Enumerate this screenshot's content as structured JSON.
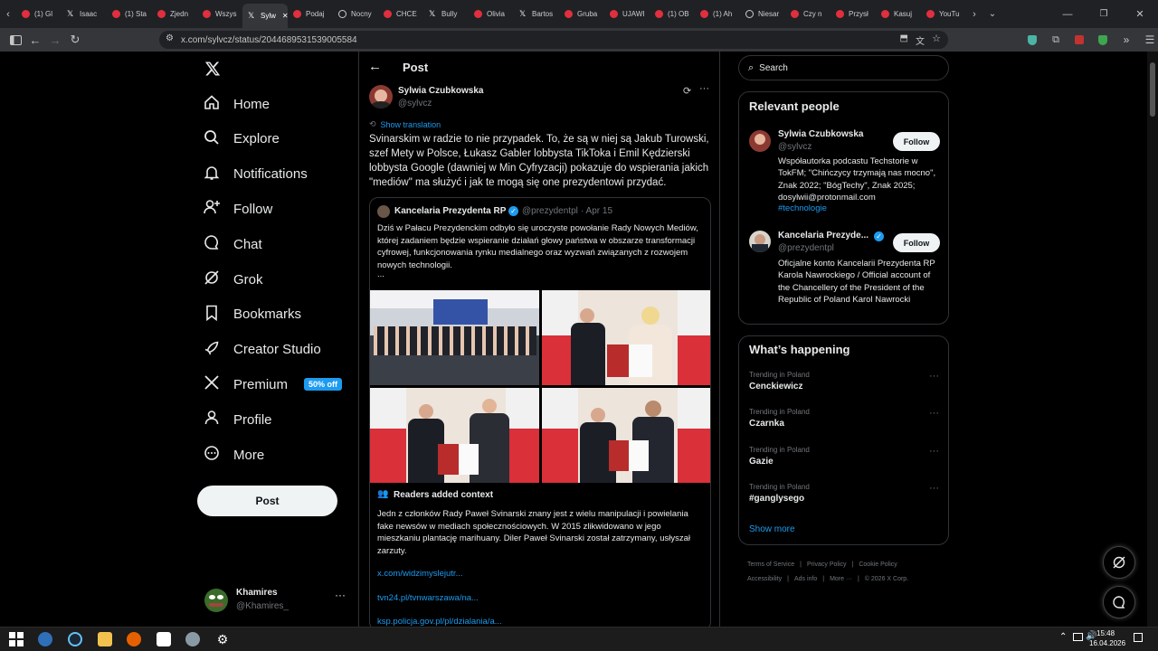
{
  "browser": {
    "tabs": [
      {
        "label": "(1) Gl",
        "icon": "youtube-icon",
        "color": "#e02f3f"
      },
      {
        "label": "Isaac",
        "icon": "x-icon",
        "color": "#ffffff"
      },
      {
        "label": "(1) Sta",
        "icon": "youtube-icon",
        "color": "#e02f3f"
      },
      {
        "label": "Zjedn",
        "icon": "youtube-icon",
        "color": "#e02f3f"
      },
      {
        "label": "Wszys",
        "icon": "youtube-icon",
        "color": "#e02f3f"
      },
      {
        "label": "Sylw",
        "icon": "x-icon",
        "color": "#ffffff",
        "active": true
      },
      {
        "label": "Podaj",
        "icon": "youtube-icon",
        "color": "#e02f3f"
      },
      {
        "label": "Nocny",
        "icon": "globe-icon",
        "color": "#c9cdd2"
      },
      {
        "label": "CHCE",
        "icon": "youtube-icon",
        "color": "#e02f3f"
      },
      {
        "label": "Bully",
        "icon": "x-icon",
        "color": "#ffffff"
      },
      {
        "label": "Olivia",
        "icon": "youtube-icon",
        "color": "#e02f3f"
      },
      {
        "label": "Bartos",
        "icon": "x-icon",
        "color": "#ffffff"
      },
      {
        "label": "Gruba",
        "icon": "youtube-icon",
        "color": "#e02f3f"
      },
      {
        "label": "UJAWI",
        "icon": "youtube-icon",
        "color": "#e02f3f"
      },
      {
        "label": "(1) OB",
        "icon": "youtube-icon",
        "color": "#e02f3f"
      },
      {
        "label": "(1) Ah",
        "icon": "youtube-icon",
        "color": "#e02f3f"
      },
      {
        "label": "Niesar",
        "icon": "globe-icon",
        "color": "#c9cdd2"
      },
      {
        "label": "Czy n",
        "icon": "youtube-icon",
        "color": "#e02f3f"
      },
      {
        "label": "Przysł",
        "icon": "youtube-icon",
        "color": "#e02f3f"
      },
      {
        "label": "Kasuj",
        "icon": "youtube-icon",
        "color": "#e02f3f"
      },
      {
        "label": "YouTu",
        "icon": "youtube-icon",
        "color": "#e02f3f"
      }
    ],
    "url": "x.com/sylvcz/status/2044689531539005584"
  },
  "nav": {
    "items": [
      {
        "label": "Home",
        "icon": "home-icon"
      },
      {
        "label": "Explore",
        "icon": "search-icon"
      },
      {
        "label": "Notifications",
        "icon": "bell-icon"
      },
      {
        "label": "Follow",
        "icon": "add-person-icon"
      },
      {
        "label": "Chat",
        "icon": "chat-icon"
      },
      {
        "label": "Grok",
        "icon": "grok-icon"
      },
      {
        "label": "Bookmarks",
        "icon": "bookmark-icon"
      },
      {
        "label": "Creator Studio",
        "icon": "rocket-icon"
      },
      {
        "label": "Premium",
        "icon": "x-logo-icon",
        "badge": "50% off"
      },
      {
        "label": "Profile",
        "icon": "person-icon"
      },
      {
        "label": "More",
        "icon": "more-circle-icon"
      }
    ],
    "post_button": "Post",
    "account": {
      "name": "Khamires",
      "handle": "@Khamires_"
    }
  },
  "post": {
    "header_title": "Post",
    "author": {
      "name": "Sylwia Czubkowska",
      "handle": "@sylvcz"
    },
    "show_translation": "Show translation",
    "text": "Svinarskim w radzie to nie przypadek. To, że są w niej są Jakub Turowski, szef Mety w Polsce, Łukasz Gabler lobbysta TikToka i Emil Kędzierski lobbysta Google (dawniej w Min Cyfryzacji) pokazuje do wspierania jakich \"mediów\" ma służyć i jak te mogą się one prezydentowi przydać.",
    "quote": {
      "author": "Kancelaria Prezydenta RP",
      "handle": "@prezydentpl",
      "date": "· Apr 15",
      "text": "Dziś w Pałacu Prezydenckim odbyło się uroczyste powołanie Rady Nowych Mediów, której zadaniem będzie wspieranie działań głowy państwa w obszarze transformacji cyfrowej, funkcjonowania rynku medialnego oraz wyzwań związanych z rozwojem nowych technologii.",
      "ellipsis": "..."
    },
    "context": {
      "title": "Readers added context",
      "text": "Jedn z członków Rady Paweł Svinarski znany jest z wielu manipulacji i powielania fake newsów w mediach społecznościowych. W 2015 zlikwidowano w jego mieszkaniu plantację marihuany. Diler Paweł Svinarski został zatrzymany, usłyszał zarzuty.",
      "links": [
        "x.com/widzimyslejutr...",
        "tvn24.pl/tvnwarszawa/na...",
        "ksp.policja.gov.pl/pl/dzialania/a..."
      ]
    }
  },
  "right": {
    "search_placeholder": "Search",
    "relevant_title": "Relevant people",
    "people": [
      {
        "name": "Sylwia Czubkowska",
        "handle": "@sylvcz",
        "follow": "Follow",
        "bio": "Współautorka podcastu Techstorie w TokFM; \"Chińczycy trzymają nas mocno\", Znak 2022; \"BógTechy\", Znak 2025; dosylwii@protonmail.com",
        "tag": "#technologie"
      },
      {
        "name": "Kancelaria Prezyde...",
        "handle": "@prezydentpl",
        "follow": "Follow",
        "bio": "Oficjalne konto Kancelarii Prezydenta RP Karola Nawrockiego / Official account of the Chancellery of the President of the Republic of Poland Karol Nawrocki",
        "tag": ""
      }
    ],
    "happening_title": "What’s happening",
    "trends": [
      {
        "meta": "Trending in Poland",
        "name": "Cenckiewicz"
      },
      {
        "meta": "Trending in Poland",
        "name": "Czarnka"
      },
      {
        "meta": "Trending in Poland",
        "name": "Gazie"
      },
      {
        "meta": "Trending in Poland",
        "name": "#ganglysego"
      }
    ],
    "show_more": "Show more",
    "footer": {
      "row1": [
        "Terms of Service",
        "Privacy Policy",
        "Cookie Policy"
      ],
      "row2": [
        "Accessibility",
        "Ads info",
        "More ···",
        "© 2026 X Corp."
      ]
    }
  },
  "taskbar": {
    "time": "15:48",
    "date": "16.04.2026"
  }
}
